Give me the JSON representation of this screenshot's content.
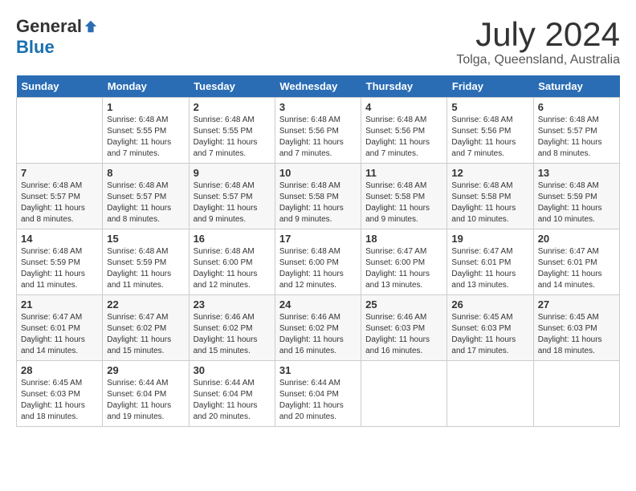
{
  "header": {
    "logo_general": "General",
    "logo_blue": "Blue",
    "month": "July 2024",
    "location": "Tolga, Queensland, Australia"
  },
  "calendar": {
    "days_of_week": [
      "Sunday",
      "Monday",
      "Tuesday",
      "Wednesday",
      "Thursday",
      "Friday",
      "Saturday"
    ],
    "weeks": [
      [
        {
          "day": "",
          "info": ""
        },
        {
          "day": "1",
          "info": "Sunrise: 6:48 AM\nSunset: 5:55 PM\nDaylight: 11 hours and 7 minutes."
        },
        {
          "day": "2",
          "info": "Sunrise: 6:48 AM\nSunset: 5:55 PM\nDaylight: 11 hours and 7 minutes."
        },
        {
          "day": "3",
          "info": "Sunrise: 6:48 AM\nSunset: 5:56 PM\nDaylight: 11 hours and 7 minutes."
        },
        {
          "day": "4",
          "info": "Sunrise: 6:48 AM\nSunset: 5:56 PM\nDaylight: 11 hours and 7 minutes."
        },
        {
          "day": "5",
          "info": "Sunrise: 6:48 AM\nSunset: 5:56 PM\nDaylight: 11 hours and 7 minutes."
        },
        {
          "day": "6",
          "info": "Sunrise: 6:48 AM\nSunset: 5:57 PM\nDaylight: 11 hours and 8 minutes."
        }
      ],
      [
        {
          "day": "7",
          "info": "Sunrise: 6:48 AM\nSunset: 5:57 PM\nDaylight: 11 hours and 8 minutes."
        },
        {
          "day": "8",
          "info": "Sunrise: 6:48 AM\nSunset: 5:57 PM\nDaylight: 11 hours and 8 minutes."
        },
        {
          "day": "9",
          "info": "Sunrise: 6:48 AM\nSunset: 5:57 PM\nDaylight: 11 hours and 9 minutes."
        },
        {
          "day": "10",
          "info": "Sunrise: 6:48 AM\nSunset: 5:58 PM\nDaylight: 11 hours and 9 minutes."
        },
        {
          "day": "11",
          "info": "Sunrise: 6:48 AM\nSunset: 5:58 PM\nDaylight: 11 hours and 9 minutes."
        },
        {
          "day": "12",
          "info": "Sunrise: 6:48 AM\nSunset: 5:58 PM\nDaylight: 11 hours and 10 minutes."
        },
        {
          "day": "13",
          "info": "Sunrise: 6:48 AM\nSunset: 5:59 PM\nDaylight: 11 hours and 10 minutes."
        }
      ],
      [
        {
          "day": "14",
          "info": "Sunrise: 6:48 AM\nSunset: 5:59 PM\nDaylight: 11 hours and 11 minutes."
        },
        {
          "day": "15",
          "info": "Sunrise: 6:48 AM\nSunset: 5:59 PM\nDaylight: 11 hours and 11 minutes."
        },
        {
          "day": "16",
          "info": "Sunrise: 6:48 AM\nSunset: 6:00 PM\nDaylight: 11 hours and 12 minutes."
        },
        {
          "day": "17",
          "info": "Sunrise: 6:48 AM\nSunset: 6:00 PM\nDaylight: 11 hours and 12 minutes."
        },
        {
          "day": "18",
          "info": "Sunrise: 6:47 AM\nSunset: 6:00 PM\nDaylight: 11 hours and 13 minutes."
        },
        {
          "day": "19",
          "info": "Sunrise: 6:47 AM\nSunset: 6:01 PM\nDaylight: 11 hours and 13 minutes."
        },
        {
          "day": "20",
          "info": "Sunrise: 6:47 AM\nSunset: 6:01 PM\nDaylight: 11 hours and 14 minutes."
        }
      ],
      [
        {
          "day": "21",
          "info": "Sunrise: 6:47 AM\nSunset: 6:01 PM\nDaylight: 11 hours and 14 minutes."
        },
        {
          "day": "22",
          "info": "Sunrise: 6:47 AM\nSunset: 6:02 PM\nDaylight: 11 hours and 15 minutes."
        },
        {
          "day": "23",
          "info": "Sunrise: 6:46 AM\nSunset: 6:02 PM\nDaylight: 11 hours and 15 minutes."
        },
        {
          "day": "24",
          "info": "Sunrise: 6:46 AM\nSunset: 6:02 PM\nDaylight: 11 hours and 16 minutes."
        },
        {
          "day": "25",
          "info": "Sunrise: 6:46 AM\nSunset: 6:03 PM\nDaylight: 11 hours and 16 minutes."
        },
        {
          "day": "26",
          "info": "Sunrise: 6:45 AM\nSunset: 6:03 PM\nDaylight: 11 hours and 17 minutes."
        },
        {
          "day": "27",
          "info": "Sunrise: 6:45 AM\nSunset: 6:03 PM\nDaylight: 11 hours and 18 minutes."
        }
      ],
      [
        {
          "day": "28",
          "info": "Sunrise: 6:45 AM\nSunset: 6:03 PM\nDaylight: 11 hours and 18 minutes."
        },
        {
          "day": "29",
          "info": "Sunrise: 6:44 AM\nSunset: 6:04 PM\nDaylight: 11 hours and 19 minutes."
        },
        {
          "day": "30",
          "info": "Sunrise: 6:44 AM\nSunset: 6:04 PM\nDaylight: 11 hours and 20 minutes."
        },
        {
          "day": "31",
          "info": "Sunrise: 6:44 AM\nSunset: 6:04 PM\nDaylight: 11 hours and 20 minutes."
        },
        {
          "day": "",
          "info": ""
        },
        {
          "day": "",
          "info": ""
        },
        {
          "day": "",
          "info": ""
        }
      ]
    ]
  }
}
